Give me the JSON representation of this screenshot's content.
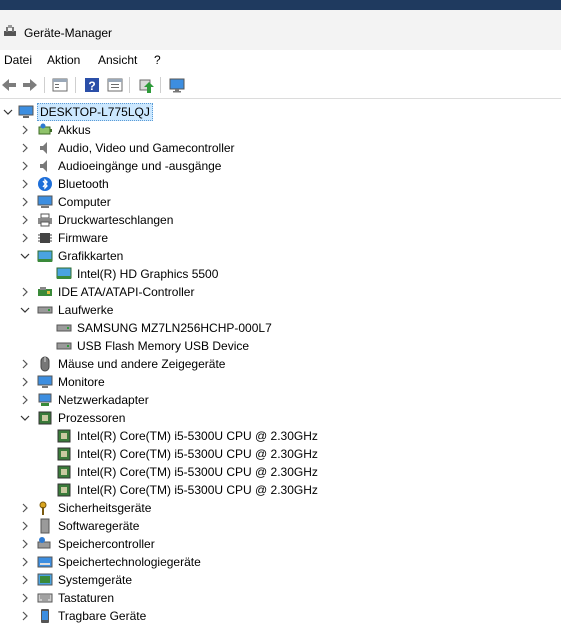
{
  "window": {
    "title": "Geräte-Manager"
  },
  "menu": {
    "items": [
      "Datei",
      "Aktion",
      "Ansicht",
      "?"
    ]
  },
  "toolbar": {
    "buttons": [
      "back-icon",
      "forward-icon",
      "properties-icon",
      "help-icon",
      "view-icon",
      "update-driver-icon",
      "monitor-icon"
    ]
  },
  "tree": {
    "root": "DESKTOP-L775LQJ",
    "items": [
      {
        "label": "Akkus",
        "icon": "battery-icon",
        "expanded": false
      },
      {
        "label": "Audio, Video und Gamecontroller",
        "icon": "speaker-icon",
        "expanded": false
      },
      {
        "label": "Audioeingänge und -ausgänge",
        "icon": "speaker-icon",
        "expanded": false
      },
      {
        "label": "Bluetooth",
        "icon": "bluetooth-icon",
        "expanded": false
      },
      {
        "label": "Computer",
        "icon": "computer-icon",
        "expanded": false
      },
      {
        "label": "Druckwarteschlangen",
        "icon": "printer-icon",
        "expanded": false
      },
      {
        "label": "Firmware",
        "icon": "chip-icon",
        "expanded": false
      },
      {
        "label": "Grafikkarten",
        "icon": "display-adapter-icon",
        "expanded": true,
        "children": [
          "Intel(R) HD Graphics 5500"
        ]
      },
      {
        "label": "IDE ATA/ATAPI-Controller",
        "icon": "controller-icon",
        "expanded": false
      },
      {
        "label": "Laufwerke",
        "icon": "drive-icon",
        "expanded": true,
        "children": [
          "SAMSUNG MZ7LN256HCHP-000L7",
          "USB Flash Memory USB Device"
        ]
      },
      {
        "label": "Mäuse und andere Zeigegeräte",
        "icon": "mouse-icon",
        "expanded": false
      },
      {
        "label": "Monitore",
        "icon": "monitor-icon",
        "expanded": false
      },
      {
        "label": "Netzwerkadapter",
        "icon": "network-icon",
        "expanded": false
      },
      {
        "label": "Prozessoren",
        "icon": "cpu-icon",
        "expanded": true,
        "children": [
          "Intel(R) Core(TM) i5-5300U CPU @ 2.30GHz",
          "Intel(R) Core(TM) i5-5300U CPU @ 2.30GHz",
          "Intel(R) Core(TM) i5-5300U CPU @ 2.30GHz",
          "Intel(R) Core(TM) i5-5300U CPU @ 2.30GHz"
        ]
      },
      {
        "label": "Sicherheitsgeräte",
        "icon": "key-icon",
        "expanded": false
      },
      {
        "label": "Softwaregeräte",
        "icon": "software-device-icon",
        "expanded": false
      },
      {
        "label": "Speichercontroller",
        "icon": "storage-controller-icon",
        "expanded": false
      },
      {
        "label": "Speichertechnologiegeräte",
        "icon": "storage-tech-icon",
        "expanded": false
      },
      {
        "label": "Systemgeräte",
        "icon": "system-device-icon",
        "expanded": false
      },
      {
        "label": "Tastaturen",
        "icon": "keyboard-icon",
        "expanded": false
      },
      {
        "label": "Tragbare Geräte",
        "icon": "portable-device-icon",
        "expanded": false
      }
    ]
  },
  "colors": {
    "selection": "#cce8ff",
    "selection_border": "#5b9bd5",
    "accent": "#1f3a5f"
  }
}
